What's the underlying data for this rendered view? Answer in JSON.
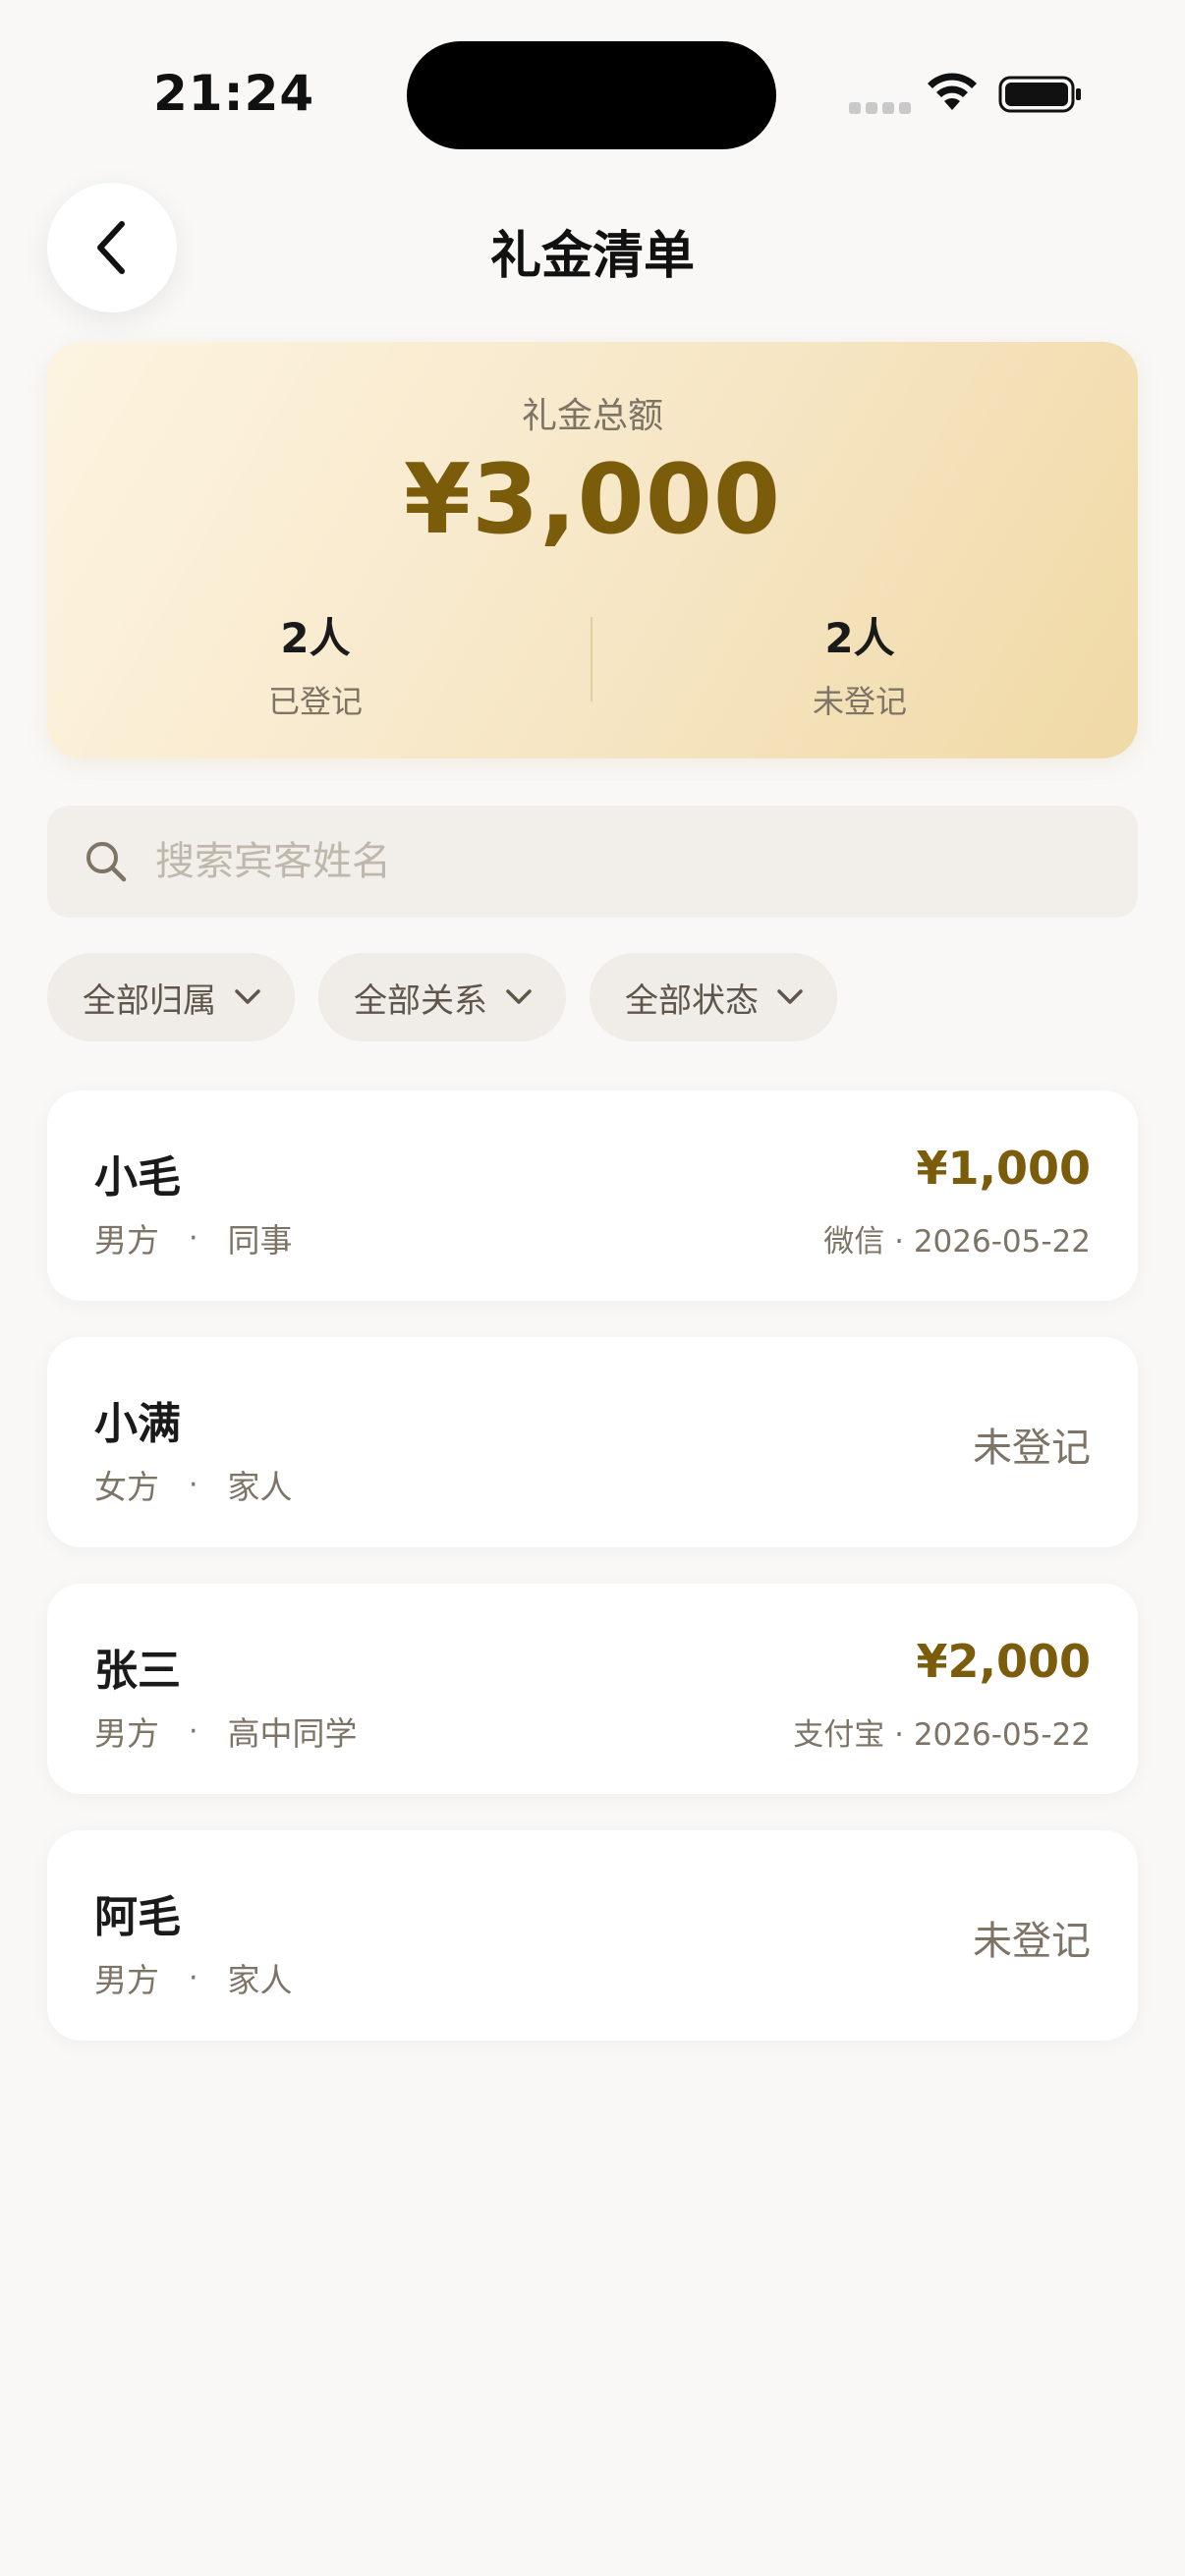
{
  "status_bar": {
    "time": "21:24"
  },
  "header": {
    "title": "礼金清单"
  },
  "summary": {
    "label": "礼金总额",
    "amount": "¥3,000",
    "registered_count": "2人",
    "registered_label": "已登记",
    "unregistered_count": "2人",
    "unregistered_label": "未登记"
  },
  "search": {
    "placeholder": "搜索宾客姓名",
    "value": ""
  },
  "filters": [
    {
      "label": "全部归属"
    },
    {
      "label": "全部关系"
    },
    {
      "label": "全部状态"
    }
  ],
  "guests": [
    {
      "name": "小毛",
      "side": "男方",
      "relation": "同事",
      "amount": "¥1,000",
      "detail": "微信 · 2026-05-22"
    },
    {
      "name": "小满",
      "side": "女方",
      "relation": "家人",
      "status": "未登记"
    },
    {
      "name": "张三",
      "side": "男方",
      "relation": "高中同学",
      "amount": "¥2,000",
      "detail": "支付宝 · 2026-05-22"
    },
    {
      "name": "阿毛",
      "side": "男方",
      "relation": "家人",
      "status": "未登记"
    }
  ],
  "colors": {
    "accent": "#7a5c0a",
    "background": "#f9f8f6",
    "muted": "#7d7466"
  },
  "icons": [
    "chevron-left-icon",
    "search-icon",
    "chevron-down-icon",
    "wifi-icon",
    "battery-icon",
    "signal-icon"
  ]
}
